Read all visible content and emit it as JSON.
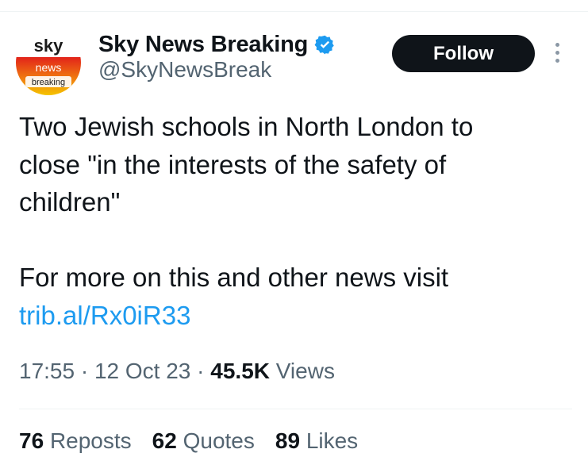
{
  "user": {
    "display_name": "Sky News Breaking",
    "handle": "@SkyNewsBreak",
    "verified": true,
    "avatar_logo": {
      "line1": "sky",
      "line2": "news",
      "line3": "breaking"
    }
  },
  "follow_button": {
    "label": "Follow"
  },
  "tweet": {
    "text_lines": [
      "Two Jewish schools in North London to",
      "close \"in the interests of the safety of",
      "children\""
    ],
    "text_line2_prefix": "For more on this and other news visit",
    "link": "trib.al/Rx0iR33"
  },
  "meta": {
    "time": "17:55",
    "date": "12 Oct 23",
    "views_count": "45.5K",
    "views_label": "Views",
    "separator": "·"
  },
  "stats": {
    "reposts": {
      "count": "76",
      "label": "Reposts"
    },
    "quotes": {
      "count": "62",
      "label": "Quotes"
    },
    "likes": {
      "count": "89",
      "label": "Likes"
    }
  },
  "colors": {
    "link": "#1d9bf0",
    "secondary_text": "#536471",
    "primary_text": "#0f1419",
    "verified_badge": "#1d9bf0",
    "sky_red": "#e2231a",
    "sky_yellow": "#f5c400"
  }
}
